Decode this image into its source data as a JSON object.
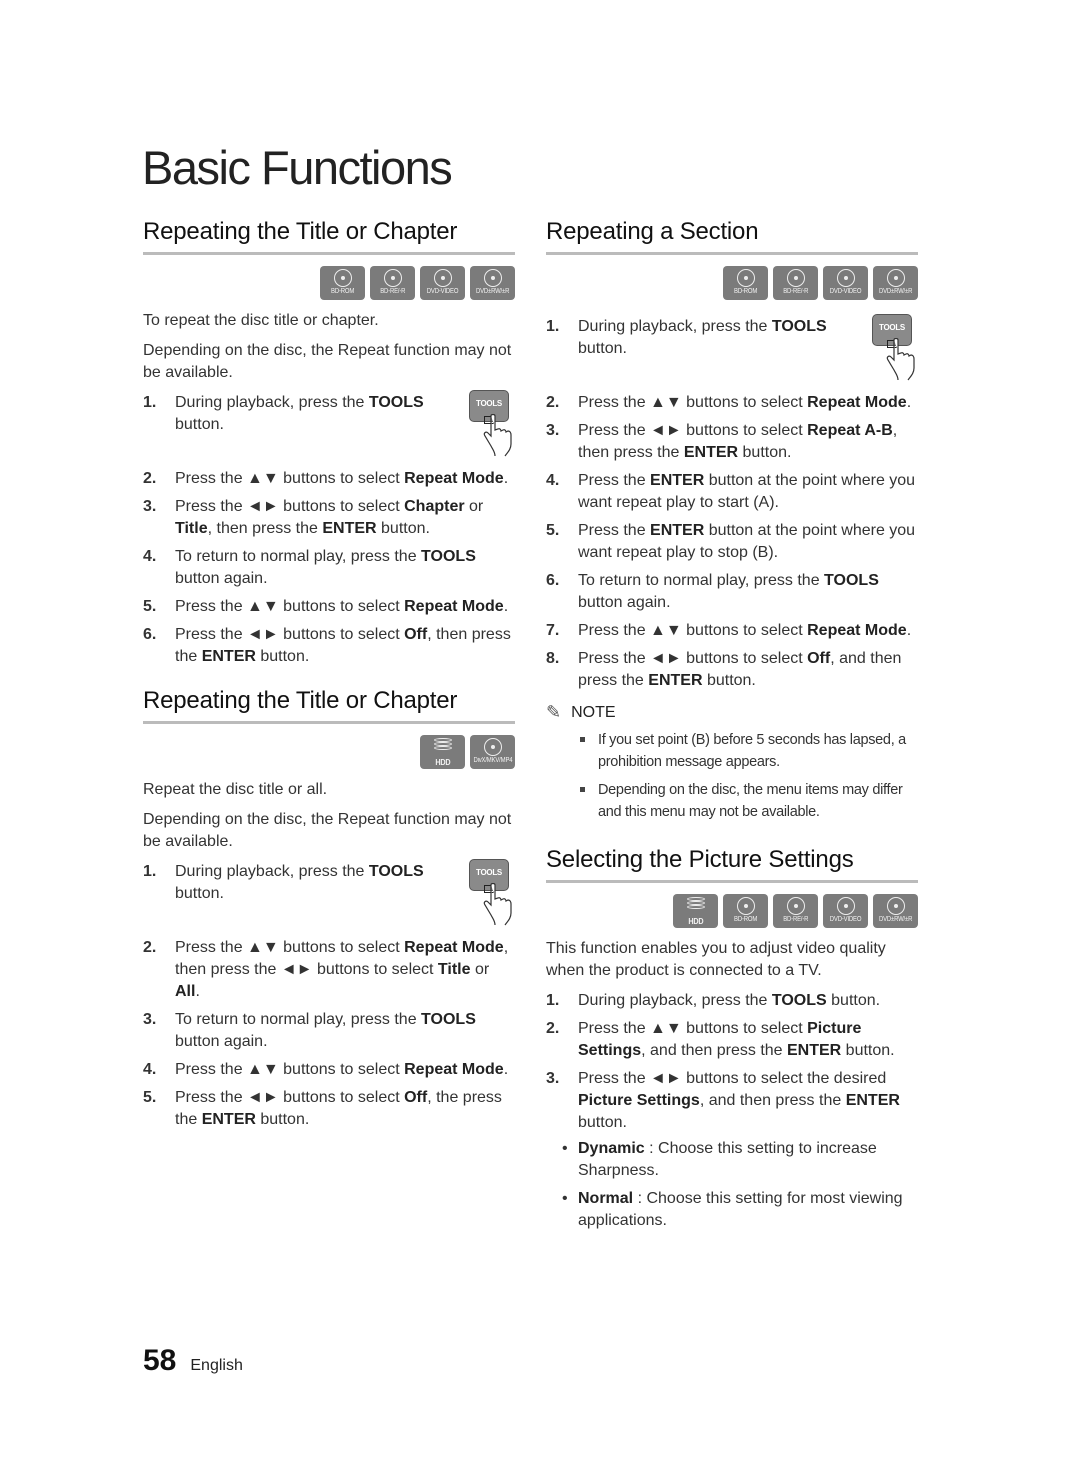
{
  "page": {
    "title": "Basic Functions",
    "page_number": "58",
    "language": "English"
  },
  "left": {
    "section1": {
      "title": "Repeating the Title or Chapter",
      "badges": [
        {
          "icon": "disc-icon",
          "label": "BD-ROM"
        },
        {
          "icon": "disc-icon",
          "label": "BD-RE/-R"
        },
        {
          "icon": "disc-icon",
          "label": "DVD-VIDEO"
        },
        {
          "icon": "disc-icon",
          "label": "DVD±RW/±R"
        }
      ],
      "intro": [
        "To repeat the disc title or chapter.",
        "Depending on the disc, the Repeat function may not be available."
      ],
      "tools_label": "TOOLS",
      "steps": [
        {
          "num": "1.",
          "parts": [
            [
              "During playback, press the ",
              false
            ],
            [
              "TOOLS",
              true
            ],
            [
              " button.",
              false
            ]
          ]
        },
        {
          "num": "2.",
          "parts": [
            [
              "Press the ▲▼ buttons to select ",
              false
            ],
            [
              "Repeat Mode",
              true
            ],
            [
              ".",
              false
            ]
          ]
        },
        {
          "num": "3.",
          "parts": [
            [
              "Press the ◄► buttons to select ",
              false
            ],
            [
              "Chapter",
              true
            ],
            [
              " or ",
              false
            ],
            [
              "Title",
              true
            ],
            [
              ", then press the ",
              false
            ],
            [
              "ENTER",
              true
            ],
            [
              " button.",
              false
            ]
          ]
        },
        {
          "num": "4.",
          "parts": [
            [
              "To return to normal play, press the ",
              false
            ],
            [
              "TOOLS",
              true
            ],
            [
              " button again.",
              false
            ]
          ]
        },
        {
          "num": "5.",
          "parts": [
            [
              "Press the ▲▼ buttons to select ",
              false
            ],
            [
              "Repeat Mode",
              true
            ],
            [
              ".",
              false
            ]
          ]
        },
        {
          "num": "6.",
          "parts": [
            [
              "Press the ◄► buttons to select ",
              false
            ],
            [
              "Off",
              true
            ],
            [
              ", then press the ",
              false
            ],
            [
              "ENTER",
              true
            ],
            [
              " button.",
              false
            ]
          ]
        }
      ]
    },
    "section2": {
      "title": "Repeating the Title or Chapter",
      "badges": [
        {
          "icon": "hdd-icon",
          "label": "HDD"
        },
        {
          "icon": "film-reel-icon",
          "label": "DivX/MKV/MP4"
        }
      ],
      "intro": [
        "Repeat the disc title or all.",
        "Depending on the disc, the Repeat function may not be available."
      ],
      "tools_label": "TOOLS",
      "steps": [
        {
          "num": "1.",
          "parts": [
            [
              "During playback, press the ",
              false
            ],
            [
              "TOOLS",
              true
            ],
            [
              " button.",
              false
            ]
          ]
        },
        {
          "num": "2.",
          "parts": [
            [
              "Press the ▲▼ buttons to select ",
              false
            ],
            [
              "Repeat Mode",
              true
            ],
            [
              ", then press the ◄► buttons to select ",
              false
            ],
            [
              "Title",
              true
            ],
            [
              " or ",
              false
            ],
            [
              "All",
              true
            ],
            [
              ".",
              false
            ]
          ]
        },
        {
          "num": "3.",
          "parts": [
            [
              "To return to normal play, press the ",
              false
            ],
            [
              "TOOLS",
              true
            ],
            [
              " button again.",
              false
            ]
          ]
        },
        {
          "num": "4.",
          "parts": [
            [
              "Press the ▲▼ buttons to select ",
              false
            ],
            [
              "Repeat Mode",
              true
            ],
            [
              ".",
              false
            ]
          ]
        },
        {
          "num": "5.",
          "parts": [
            [
              "Press the ◄► buttons to select ",
              false
            ],
            [
              "Off",
              true
            ],
            [
              ", the press the ",
              false
            ],
            [
              "ENTER",
              true
            ],
            [
              " button.",
              false
            ]
          ]
        }
      ]
    }
  },
  "right": {
    "section1": {
      "title": "Repeating a Section",
      "badges": [
        {
          "icon": "disc-icon",
          "label": "BD-ROM"
        },
        {
          "icon": "disc-icon",
          "label": "BD-RE/-R"
        },
        {
          "icon": "disc-icon",
          "label": "DVD-VIDEO"
        },
        {
          "icon": "disc-icon",
          "label": "DVD±RW/±R"
        }
      ],
      "tools_label": "TOOLS",
      "steps": [
        {
          "num": "1.",
          "parts": [
            [
              "During playback, press the ",
              false
            ],
            [
              "TOOLS",
              true
            ],
            [
              " button.",
              false
            ]
          ]
        },
        {
          "num": "2.",
          "parts": [
            [
              "Press the ▲▼ buttons to select ",
              false
            ],
            [
              "Repeat Mode",
              true
            ],
            [
              ".",
              false
            ]
          ]
        },
        {
          "num": "3.",
          "parts": [
            [
              "Press the ◄► buttons to select ",
              false
            ],
            [
              "Repeat A-B",
              true
            ],
            [
              ", then press the ",
              false
            ],
            [
              "ENTER",
              true
            ],
            [
              " button.",
              false
            ]
          ]
        },
        {
          "num": "4.",
          "parts": [
            [
              "Press the ",
              false
            ],
            [
              "ENTER",
              true
            ],
            [
              " button at the point where you want repeat play to start (A).",
              false
            ]
          ]
        },
        {
          "num": "5.",
          "parts": [
            [
              "Press the ",
              false
            ],
            [
              "ENTER",
              true
            ],
            [
              " button at the point where you want repeat play to stop (B).",
              false
            ]
          ]
        },
        {
          "num": "6.",
          "parts": [
            [
              "To return to normal play, press the ",
              false
            ],
            [
              "TOOLS",
              true
            ],
            [
              " button again.",
              false
            ]
          ]
        },
        {
          "num": "7.",
          "parts": [
            [
              "Press the ▲▼ buttons to select ",
              false
            ],
            [
              "Repeat Mode",
              true
            ],
            [
              ".",
              false
            ]
          ]
        },
        {
          "num": "8.",
          "parts": [
            [
              "Press the ◄► buttons to select ",
              false
            ],
            [
              "Off",
              true
            ],
            [
              ", and then press the ",
              false
            ],
            [
              "ENTER",
              true
            ],
            [
              " button.",
              false
            ]
          ]
        }
      ],
      "note": {
        "label": "NOTE",
        "items": [
          "If you set point (B) before 5 seconds has lapsed, a prohibition message appears.",
          "Depending on the disc, the menu items may differ and this menu may not be available."
        ]
      }
    },
    "section2": {
      "title": "Selecting the Picture Settings",
      "badges": [
        {
          "icon": "hdd-icon",
          "label": "HDD"
        },
        {
          "icon": "disc-icon",
          "label": "BD-ROM"
        },
        {
          "icon": "disc-icon",
          "label": "BD-RE/-R"
        },
        {
          "icon": "disc-icon",
          "label": "DVD-VIDEO"
        },
        {
          "icon": "disc-icon",
          "label": "DVD±RW/±R"
        }
      ],
      "intro": [
        "This function enables you to adjust video quality when the product is connected to a TV."
      ],
      "steps": [
        {
          "num": "1.",
          "parts": [
            [
              "During playback, press the ",
              false
            ],
            [
              "TOOLS",
              true
            ],
            [
              " button.",
              false
            ]
          ]
        },
        {
          "num": "2.",
          "parts": [
            [
              "Press the ▲▼ buttons to select ",
              false
            ],
            [
              "Picture Settings",
              true
            ],
            [
              ", and then press the ",
              false
            ],
            [
              "ENTER",
              true
            ],
            [
              " button.",
              false
            ]
          ]
        },
        {
          "num": "3.",
          "parts": [
            [
              "Press the ◄► buttons to select the desired ",
              false
            ],
            [
              "Picture Settings",
              true
            ],
            [
              ", and then press the ",
              false
            ],
            [
              "ENTER",
              true
            ],
            [
              " button.",
              false
            ]
          ]
        }
      ],
      "options": [
        {
          "name": "Dynamic",
          "desc": " : Choose this setting to increase Sharpness."
        },
        {
          "name": "Normal",
          "desc": " : Choose this setting for most viewing applications."
        }
      ]
    }
  }
}
